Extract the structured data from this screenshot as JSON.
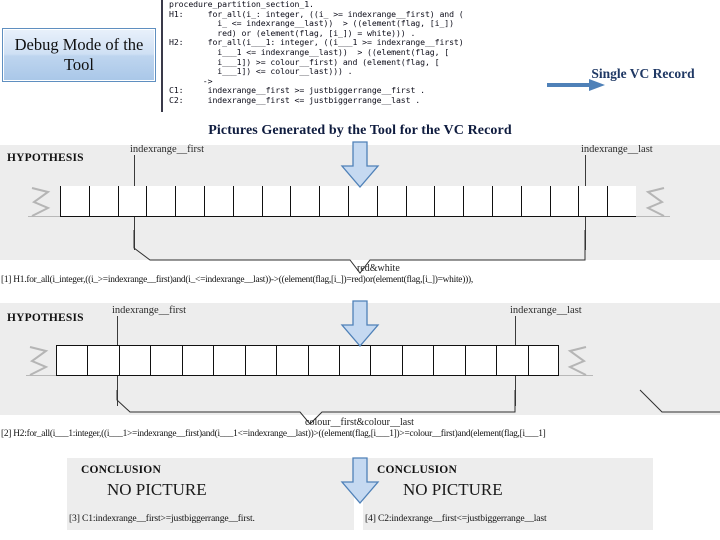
{
  "callout": {
    "text": "Debug Mode of the Tool"
  },
  "code": {
    "text": "procedure_partition_section_1.\nH1:     for_all(i_: integer, ((i_ >= indexrange__first) and (\n          i_ <= indexrange__last))  > ((element(flag, [i_])\n          red) or (element(flag, [i_]) = white))) .\nH2:     for_all(i___1: integer, ((i___1 >= indexrange__first)\n          i___1 <= indexrange__last))  > ((element(flag, [\n          i___1]) >= colour__first) and (element(flag, [\n          i___1]) <= colour__last))) .\n       ->\nC1:     indexrange__first >= justbiggerrange__first .\nC2:     indexrange__first <= justbiggerrange__last ."
  },
  "vc_record": {
    "label": "Single VC Record",
    "arrow_color": "#4f81b8",
    "label_color": "#1f3864"
  },
  "section": {
    "title": "Pictures Generated by the Tool for the VC Record"
  },
  "picture1": {
    "hypothesis_label": "HYPOTHESIS",
    "left_marker": "indexrange__first",
    "right_marker": "indexrange__last",
    "brace_label": "red&white",
    "cells": 20,
    "formula": "[1] H1.for_all(i_integer,((i_>=indexrange__first)and(i_<=indexrange__last))->((element(flag,[i_])=red)or(element(flag,[i_])=white))),"
  },
  "picture2": {
    "hypothesis_label": "HYPOTHESIS",
    "left_marker": "indexrange__first",
    "right_marker": "indexrange__last",
    "brace_label": "colour__first&colour__last",
    "cells": 16,
    "formula": "[2] H2:for_all(i___1:integer,((i___1>=indexrange__first)and(i___1<=indexrange__last))>((element(flag,[i___1])>=colour__first)and(element(flag,[i___1]"
  },
  "conclusion_left": {
    "title": "CONCLUSION",
    "big_text": "NO PICTURE",
    "footer": "[3] C1:indexrange__first>=justbiggerrange__first."
  },
  "conclusion_right": {
    "title": "CONCLUSION",
    "big_text": "NO PICTURE",
    "footer": "[4] C2:indexrange__first<=justbiggerrange__last"
  },
  "colors": {
    "panel_bg": "#ededed",
    "arrow_fill": "#c5d9f1",
    "arrow_stroke": "#4f81b8",
    "callout_border": "#5f8fc0"
  }
}
